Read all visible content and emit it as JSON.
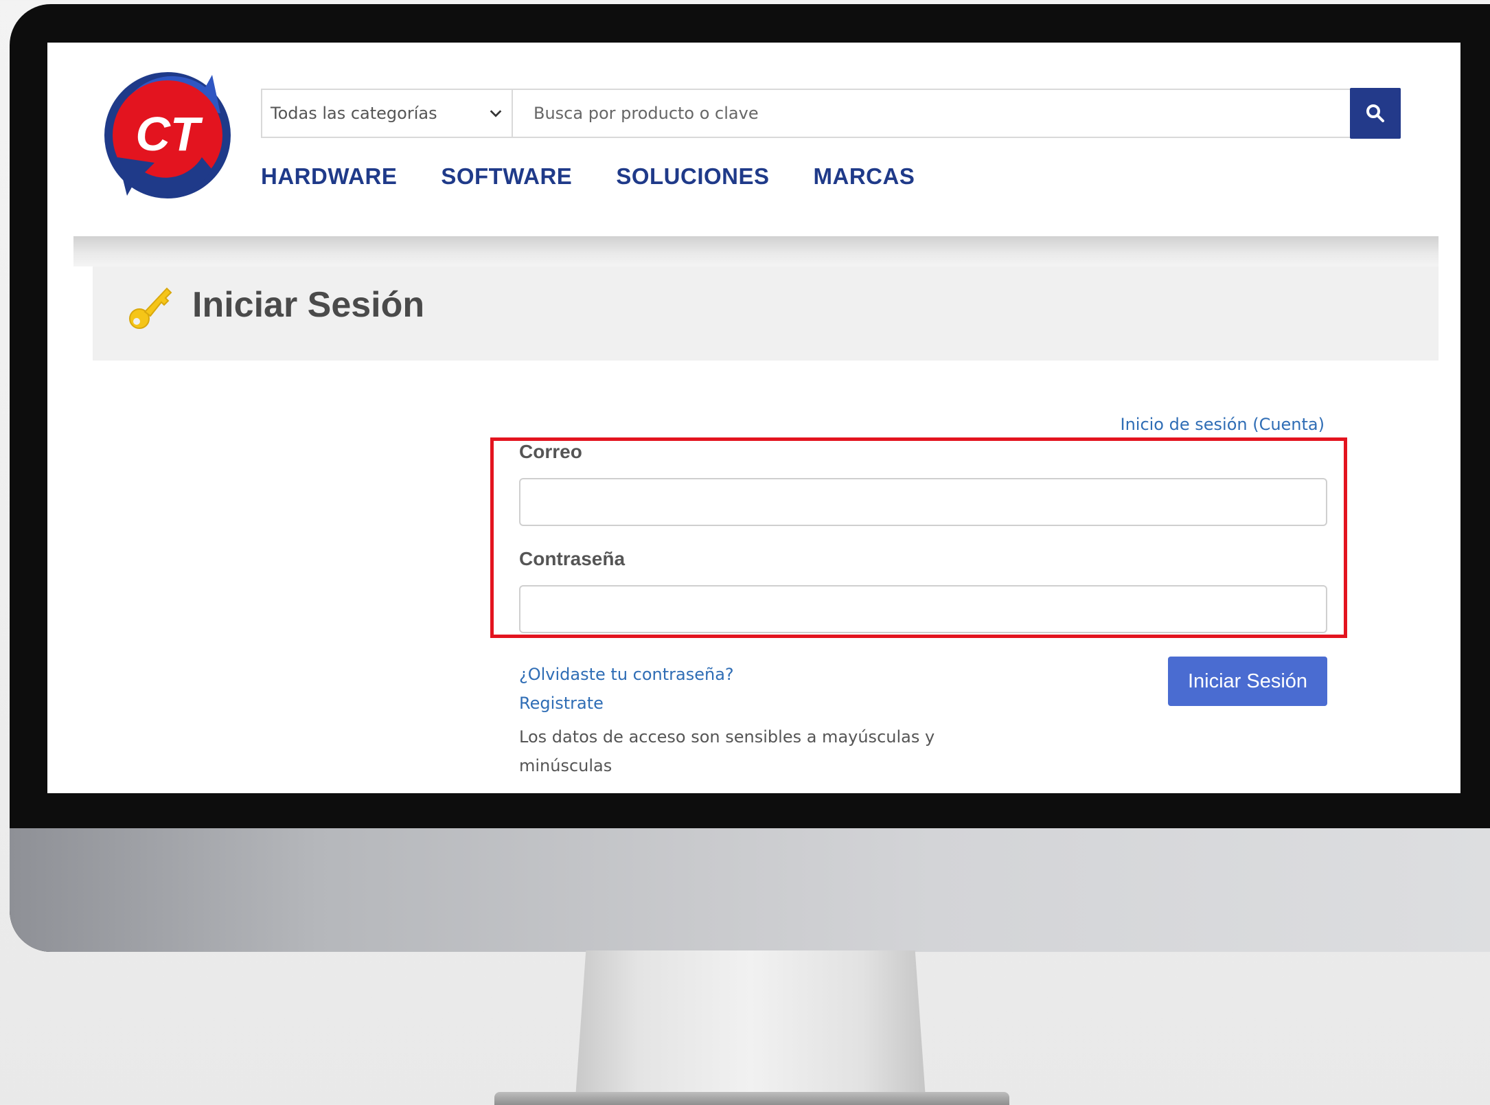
{
  "header": {
    "logo_text": "CT",
    "category_select": {
      "selected": "Todas las categorías"
    },
    "search": {
      "placeholder": "Busca por producto o clave"
    },
    "nav": [
      {
        "label": "HARDWARE"
      },
      {
        "label": "SOFTWARE"
      },
      {
        "label": "SOLUCIONES"
      },
      {
        "label": "MARCAS"
      }
    ]
  },
  "page": {
    "title": "Iniciar Sesión"
  },
  "login": {
    "account_link": "Inicio de sesión (Cuenta)",
    "email_label": "Correo",
    "email_value": "",
    "password_label": "Contraseña",
    "password_value": "",
    "forgot_link": "¿Olvidaste tu contraseña?",
    "register_link": "Registrate",
    "case_note": "Los datos de acceso son sensibles a mayúsculas y minúsculas",
    "submit_label": "Iniciar Sesión"
  },
  "colors": {
    "brand_blue": "#1f3a89",
    "search_button": "#233a8a",
    "login_button": "#4a6cd1",
    "highlight": "#e3141f",
    "logo_red": "#e3141f",
    "key_yellow": "#f5c518"
  }
}
